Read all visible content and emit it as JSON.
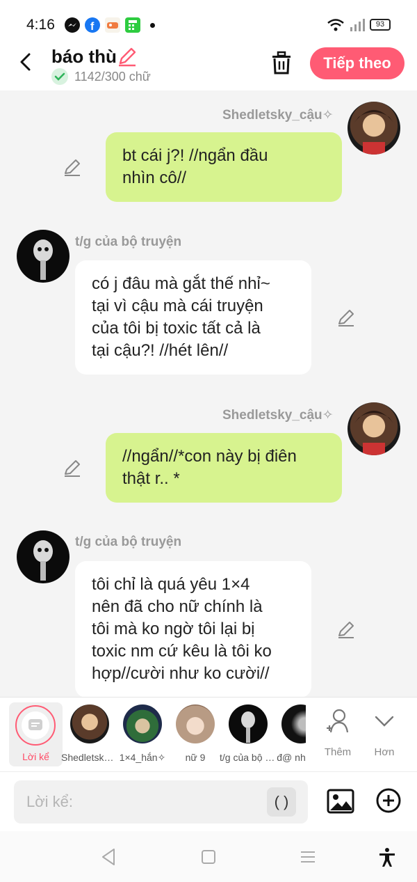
{
  "status": {
    "time": "4:16",
    "battery": "93"
  },
  "header": {
    "title": "báo thù",
    "counter": "1142/300 chữ",
    "next_label": "Tiếp theo"
  },
  "messages": [
    {
      "side": "right",
      "name": "Shedletsky_cậu✧",
      "lines": [
        "bt cái j?! //ngẩn đầu",
        "nhìn cô//"
      ]
    },
    {
      "side": "left",
      "name": "t/g của bộ truyện",
      "lines": [
        "có j đâu mà gắt thế nhỉ~",
        "tại vì cậu mà cái truyện",
        "của tôi bị toxic tất cả là",
        "tại cậu?! //hét lên//"
      ]
    },
    {
      "side": "right",
      "name": "Shedletsky_cậu✧",
      "lines": [
        "//ngẩn//*con này bị điên",
        "thật r.. *"
      ]
    },
    {
      "side": "left",
      "name": "t/g của bộ truyện",
      "lines": [
        "tôi chỉ là quá yêu 1×4",
        "nên đã cho nữ chính là",
        "tôi mà ko ngờ tôi lại bị",
        "toxic nm cứ kêu là tôi ko",
        "hợp//cười như ko cười//"
      ]
    }
  ],
  "characters": {
    "narrator_label": "Lời kể",
    "items": [
      {
        "label": "Shedletsky_cậu✧"
      },
      {
        "label": "1×4_hắn✧"
      },
      {
        "label": "nữ 9"
      },
      {
        "label": "t/g của bộ truyện"
      },
      {
        "label": "đ@ nh"
      }
    ],
    "add_label": "Thêm",
    "more_label": "Hơn"
  },
  "input": {
    "placeholder": "Lời kể:",
    "paren": "( )"
  },
  "colors": {
    "accent": "#ff5b74",
    "bubble_right": "#d7f38f",
    "bubble_left": "#ffffff"
  }
}
